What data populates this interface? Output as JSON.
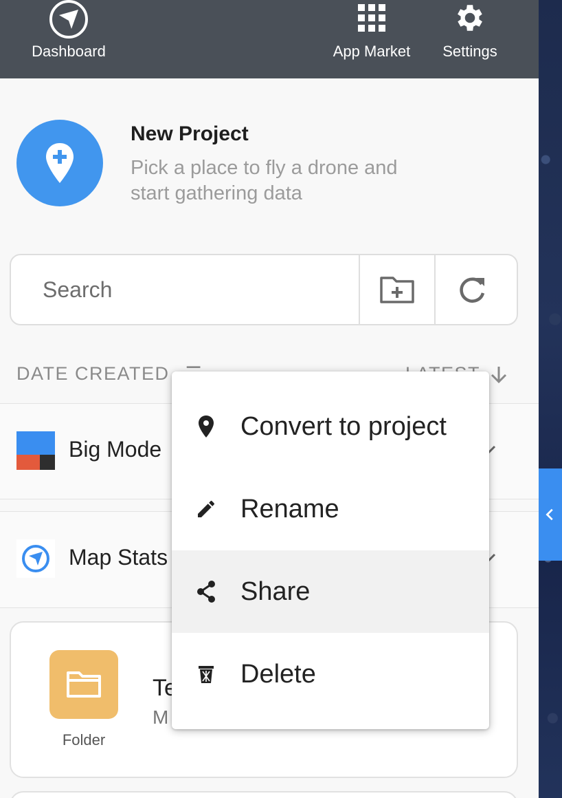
{
  "topbar": {
    "dashboard_label": "Dashboard",
    "app_market_label": "App Market",
    "settings_label": "Settings"
  },
  "new_project": {
    "title": "New Project",
    "subtitle": "Pick a place to fly a drone and start gathering data"
  },
  "search": {
    "placeholder": "Search",
    "value": ""
  },
  "sort": {
    "field_label": "DATE CREATED",
    "order_label": "LATEST"
  },
  "projects": [
    {
      "title": "Big Mode",
      "thumb": "colored-blocks"
    },
    {
      "title": "Map Stats",
      "thumb": "dronedeploy-logo"
    }
  ],
  "folder_card": {
    "tile_label": "Folder",
    "title": "Te",
    "meta": "M"
  },
  "context_menu": {
    "items": [
      {
        "label": "Convert to project",
        "icon": "map-pin-icon"
      },
      {
        "label": "Rename",
        "icon": "pencil-icon"
      },
      {
        "label": "Share",
        "icon": "share-icon"
      },
      {
        "label": "Delete",
        "icon": "trash-icon"
      }
    ],
    "hovered": "Share"
  },
  "colors": {
    "topbar": "#4a5058",
    "accent_blue": "#4196ee",
    "folder": "#f0bd6b",
    "map_tab": "#3a8ef0"
  }
}
